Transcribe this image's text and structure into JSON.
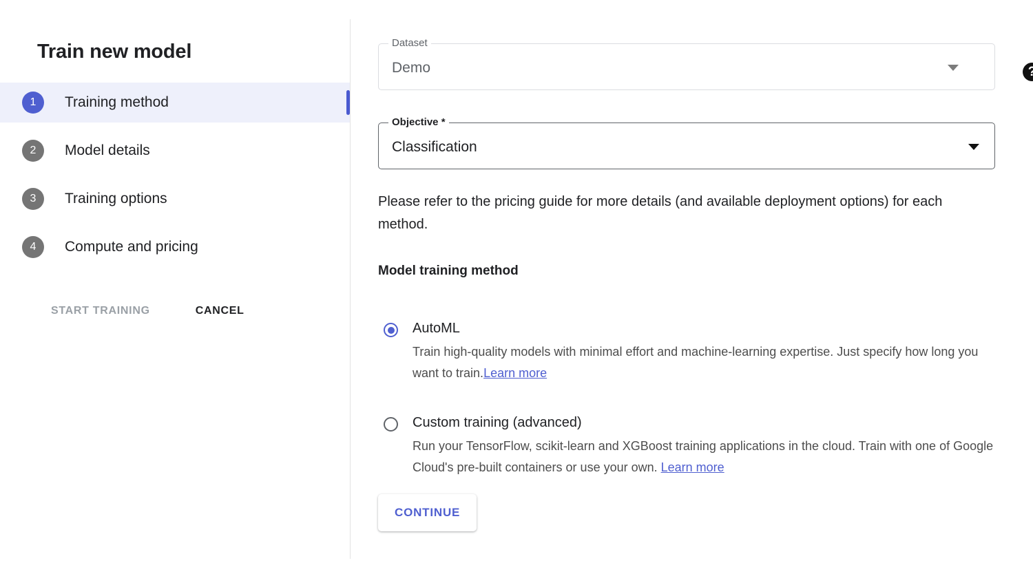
{
  "sidebar": {
    "title": "Train new model",
    "steps": [
      {
        "number": "1",
        "label": "Training method",
        "state": "active"
      },
      {
        "number": "2",
        "label": "Model details",
        "state": "inactive"
      },
      {
        "number": "3",
        "label": "Training options",
        "state": "inactive"
      },
      {
        "number": "4",
        "label": "Compute and pricing",
        "state": "inactive"
      }
    ],
    "actions": {
      "start_training_label": "START TRAINING",
      "start_training_state": "disabled",
      "cancel_label": "CANCEL"
    }
  },
  "main": {
    "dataset_field": {
      "legend": "Dataset",
      "value": "Demo",
      "state": "disabled",
      "caret_icon": "chevron-down-icon",
      "help_icon": "help-icon",
      "help_glyph": "?"
    },
    "objective_field": {
      "legend": "Objective *",
      "value": "Classification",
      "state": "enabled",
      "caret_icon": "chevron-down-icon"
    },
    "pricing_note": "Please refer to the pricing guide for more details (and available deployment options) for each method.",
    "section_heading": "Model training method",
    "options": [
      {
        "title": "AutoML",
        "selected": true,
        "desc_before": "Train high-quality models with minimal effort and machine-learning expertise. Just specify how long you want to train.",
        "link_label": "Learn more",
        "desc_after": ""
      },
      {
        "title": "Custom training (advanced)",
        "selected": false,
        "desc_before": "Run your TensorFlow, scikit-learn and XGBoost training applications in the cloud. Train with one of Google Cloud's pre-built containers or use your own. ",
        "link_label": "Learn more",
        "desc_after": ""
      }
    ],
    "continue_label": "CONTINUE"
  },
  "colors": {
    "accent": "#4f5fd0",
    "accent_bg": "#eef0fb",
    "inactive_badge": "#757575",
    "divider": "#e3e3e3",
    "text_primary": "#202124",
    "text_secondary": "#5f6368",
    "disabled_text": "#9aa0a6"
  }
}
